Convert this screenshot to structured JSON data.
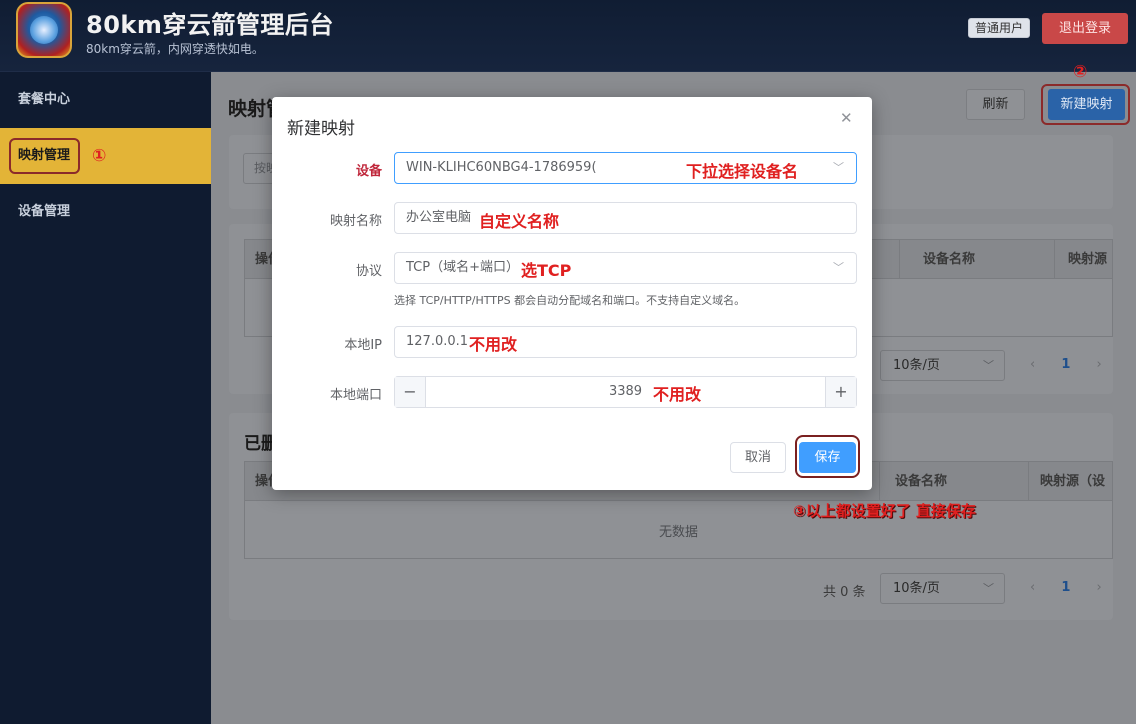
{
  "app": {
    "title": "80km穿云箭管理后台",
    "subtitle": "80km穿云箭，内网穿透快如电。",
    "user_badge": "普通用户",
    "logout_label": "退出登录"
  },
  "sidebar": {
    "items": [
      {
        "label": "套餐中心"
      },
      {
        "label": "映射管理"
      },
      {
        "label": "设备管理"
      }
    ]
  },
  "annotations": {
    "step1": "①",
    "step2": "②",
    "step3": "③以上都设置好了 直接保存"
  },
  "main": {
    "page_title": "映射管",
    "refresh_label": "刷新",
    "new_mapping_label": "新建映射",
    "search_placeholder": "按映",
    "table1": {
      "headers": [
        "操作",
        "设备名称",
        "映射源"
      ]
    },
    "pager1": {
      "page_size": "10条/页",
      "current_page": "1"
    },
    "section2_title": "已删",
    "table2": {
      "headers": [
        "操作",
        "设备名称",
        "映射源（设备"
      ],
      "empty_text": "无数据"
    },
    "pager2": {
      "total": "共 0 条",
      "page_size": "10条/页",
      "current_page": "1"
    }
  },
  "modal": {
    "title": "新建映射",
    "fields": {
      "device": {
        "label": "设备",
        "value": "WIN-KLIHC60NBG4-1786959(",
        "note": "下拉选择设备名"
      },
      "name": {
        "label": "映射名称",
        "value": "办公室电脑",
        "note": "自定义名称"
      },
      "protocol": {
        "label": "协议",
        "value": "TCP（域名+端口）",
        "note": "选TCP",
        "help": "选择 TCP/HTTP/HTTPS 都会自动分配域名和端口。不支持自定义域名。"
      },
      "local_ip": {
        "label": "本地IP",
        "value": "127.0.0.1",
        "note": "不用改"
      },
      "local_port": {
        "label": "本地端口",
        "value": "3389",
        "note": "不用改"
      }
    },
    "cancel_label": "取消",
    "save_label": "保存"
  }
}
